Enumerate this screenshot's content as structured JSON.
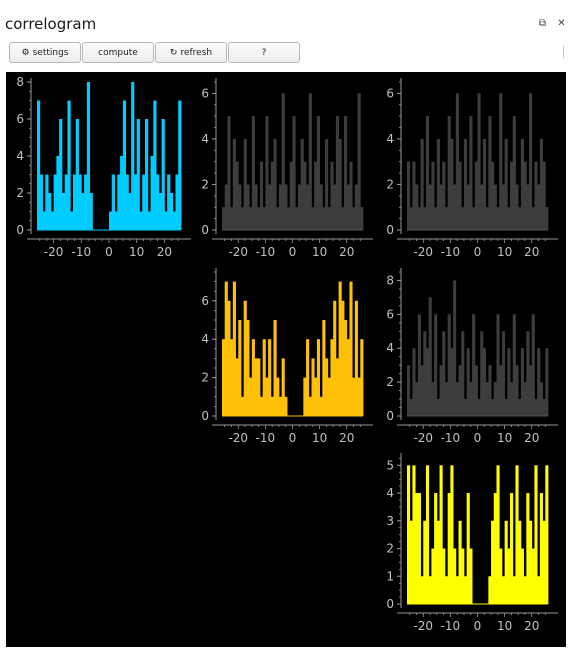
{
  "window": {
    "title": "correlogram"
  },
  "toolbar": {
    "settings": {
      "icon": "gear-icon",
      "label": "settings"
    },
    "compute": {
      "label": "compute"
    },
    "refresh": {
      "icon": "refresh-icon",
      "label": "refresh"
    },
    "help": {
      "label": "?"
    }
  },
  "chart_data": [
    {
      "type": "bar",
      "color": "#00ccff",
      "ylim": [
        0,
        8
      ],
      "yticks": [
        0,
        2,
        4,
        6,
        8
      ],
      "xticks": [
        "-20",
        "-10",
        "0",
        "10",
        "20"
      ],
      "values": [
        7,
        3,
        1,
        3,
        2,
        1,
        3,
        4,
        6,
        2,
        3,
        7,
        1,
        3,
        6,
        3,
        2,
        3,
        8,
        2,
        0,
        0,
        0,
        0,
        0,
        0,
        1,
        3,
        1,
        3,
        4,
        7,
        3,
        2,
        8,
        3,
        6,
        1,
        3,
        6,
        1,
        4,
        7,
        3,
        2,
        6,
        1,
        3,
        2,
        1,
        3,
        7
      ]
    },
    {
      "type": "bar",
      "color": "#3d3d3d",
      "ylim": [
        0,
        6.5
      ],
      "yticks": [
        0,
        2,
        4,
        6
      ],
      "xticks": [
        "-20",
        "-10",
        "0",
        "10",
        "20"
      ],
      "values": [
        1,
        2,
        5,
        1,
        4,
        3,
        2,
        1,
        4,
        2,
        1,
        5,
        2,
        1,
        3,
        1,
        5,
        2,
        3,
        4,
        1,
        2,
        6,
        2,
        1,
        3,
        5,
        1,
        2,
        4,
        3,
        2,
        6,
        1,
        3,
        5,
        2,
        1,
        4,
        1,
        3,
        2,
        5,
        4,
        1,
        5,
        2,
        3,
        1,
        2,
        6,
        1
      ]
    },
    {
      "type": "bar",
      "color": "#3d3d3d",
      "ylim": [
        0,
        6.5
      ],
      "yticks": [
        0,
        2,
        4,
        6
      ],
      "xticks": [
        "-20",
        "-10",
        "0",
        "10",
        "20"
      ],
      "values": [
        3,
        1,
        3,
        2,
        1,
        4,
        1,
        5,
        2,
        3,
        1,
        4,
        2,
        3,
        1,
        5,
        4,
        2,
        6,
        3,
        1,
        4,
        2,
        5,
        1,
        3,
        6,
        2,
        4,
        1,
        5,
        3,
        2,
        1,
        6,
        2,
        4,
        1,
        3,
        5,
        2,
        1,
        4,
        3,
        2,
        6,
        1,
        3,
        2,
        4,
        3,
        1
      ]
    },
    {
      "type": "bar",
      "color": "#ffc107",
      "ylim": [
        0,
        7.5
      ],
      "yticks": [
        0,
        2,
        4,
        6
      ],
      "xticks": [
        "-20",
        "-10",
        "0",
        "10",
        "20"
      ],
      "values": [
        4,
        7,
        6,
        4,
        7,
        3,
        5,
        1,
        6,
        5,
        2,
        4,
        3,
        3,
        1,
        4,
        2,
        4,
        1,
        5,
        2,
        1,
        3,
        1,
        0,
        0,
        0,
        0,
        0,
        0,
        2,
        4,
        1,
        3,
        2,
        4,
        1,
        5,
        3,
        2,
        4,
        6,
        3,
        7,
        6,
        5,
        4,
        7,
        2,
        6,
        2,
        4
      ]
    },
    {
      "type": "bar",
      "color": "#3d3d3d",
      "ylim": [
        0,
        8.5
      ],
      "yticks": [
        0,
        2,
        4,
        6,
        8
      ],
      "xticks": [
        "-20",
        "-10",
        "0",
        "10",
        "20"
      ],
      "values": [
        3,
        1,
        4,
        2,
        6,
        3,
        5,
        4,
        7,
        2,
        6,
        1,
        3,
        5,
        2,
        6,
        4,
        8,
        2,
        3,
        5,
        1,
        4,
        2,
        6,
        3,
        1,
        5,
        4,
        2,
        3,
        1,
        2,
        6,
        3,
        5,
        1,
        4,
        2,
        6,
        3,
        1,
        4,
        2,
        5,
        3,
        6,
        1,
        4,
        2,
        1,
        4
      ]
    },
    {
      "type": "bar",
      "color": "#ffff00",
      "ylim": [
        0,
        5.3
      ],
      "yticks": [
        0,
        1,
        2,
        3,
        4,
        5
      ],
      "xticks": [
        "-20",
        "-10",
        "0",
        "10",
        "20"
      ],
      "values": [
        5,
        3,
        5,
        4,
        4,
        1,
        3,
        5,
        1,
        2,
        4,
        3,
        5,
        2,
        1,
        4,
        5,
        2,
        1,
        3,
        2,
        1,
        4,
        2,
        0,
        0,
        0,
        0,
        0,
        0,
        1,
        3,
        4,
        5,
        2,
        1,
        3,
        2,
        4,
        1,
        5,
        3,
        2,
        1,
        4,
        3,
        2,
        5,
        1,
        4,
        3,
        5
      ]
    }
  ]
}
